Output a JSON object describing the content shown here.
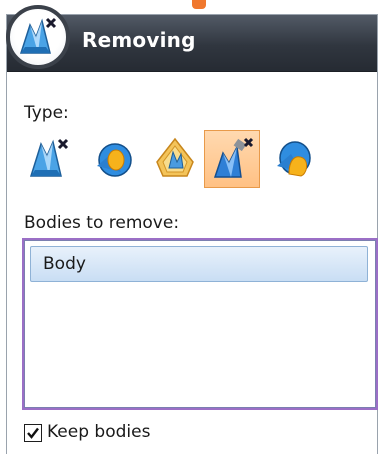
{
  "panel": {
    "title": "Removing",
    "logo_icon": "remove-body-icon"
  },
  "type_section": {
    "label": "Type:",
    "buttons": [
      {
        "icon": "remove-body-icon",
        "selected": false
      },
      {
        "icon": "blue-shell-icon",
        "selected": false
      },
      {
        "icon": "orange-shell-icon",
        "selected": false
      },
      {
        "icon": "remove-body-tool-icon",
        "selected": true
      },
      {
        "icon": "blue-body-icon",
        "selected": false
      }
    ]
  },
  "bodies_section": {
    "label": "Bodies to remove:",
    "items": [
      "Body"
    ]
  },
  "keep_bodies": {
    "label": "Keep bodies",
    "checked": true
  },
  "colors": {
    "title_bar": "#30363f",
    "selection": "#ffc184",
    "list_border": "#9b6fc6",
    "item_highlight": "#c9def4"
  }
}
